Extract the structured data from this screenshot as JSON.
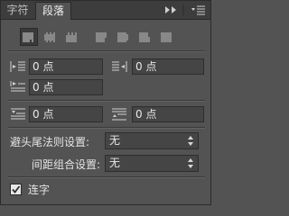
{
  "tabs": [
    {
      "label": "字符",
      "active": false
    },
    {
      "label": "段落",
      "active": true
    }
  ],
  "header_icons": [
    "panel-collapse-arrows-icon",
    "panel-menu-icon"
  ],
  "alignment": {
    "buttons": [
      "align-left-icon",
      "align-center-icon",
      "align-right-icon",
      "justify-last-left-icon",
      "justify-last-center-icon",
      "justify-last-right-icon",
      "justify-all-icon"
    ],
    "selected_index": 0
  },
  "indent": {
    "left_value": "0 点",
    "right_value": "0 点",
    "first_line_value": "0 点"
  },
  "spacing": {
    "before_value": "0 点",
    "after_value": "0 点"
  },
  "kinsoku": {
    "label": "避头尾法则设置:",
    "value": "无"
  },
  "mojikumi": {
    "label": "间距组合设置:",
    "value": "无"
  },
  "hyphenate": {
    "label": "连字",
    "checked": true
  },
  "colors": {
    "panel_bg": "#535353",
    "tab_bar_bg": "#3d3d3d",
    "field_bg": "#454545",
    "text": "#e6e6e6"
  }
}
